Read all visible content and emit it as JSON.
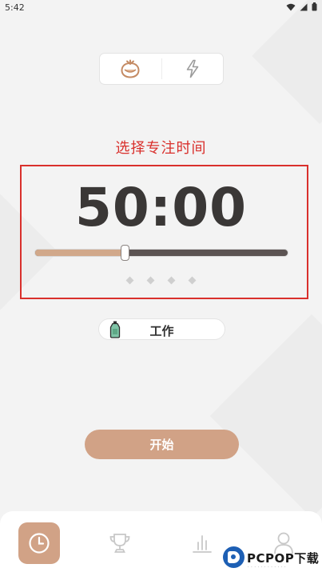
{
  "status_bar": {
    "time": "5:42"
  },
  "mode_switch": {
    "left_icon": "tomato-icon",
    "right_icon": "lightning-icon"
  },
  "caption": "选择专注时间",
  "timer": {
    "display": "50:00",
    "slider_fraction": 0.355
  },
  "pager": {
    "count": 4
  },
  "category": {
    "icon": "bottle-icon",
    "label": "工作"
  },
  "start_button": {
    "label": "开始"
  },
  "bottom_nav": {
    "items": [
      {
        "icon": "clock-icon",
        "active": true
      },
      {
        "icon": "trophy-icon",
        "active": false
      },
      {
        "icon": "bar-chart-icon",
        "active": false
      },
      {
        "icon": "person-icon",
        "active": false
      }
    ]
  },
  "watermark": {
    "text": "PCPOP下载"
  },
  "colors": {
    "accent": "#d1a286",
    "highlight_red": "#d9302c",
    "slider_track": "#5b5352",
    "slider_fill": "#d1a88a",
    "background": "#f3f3f3"
  }
}
